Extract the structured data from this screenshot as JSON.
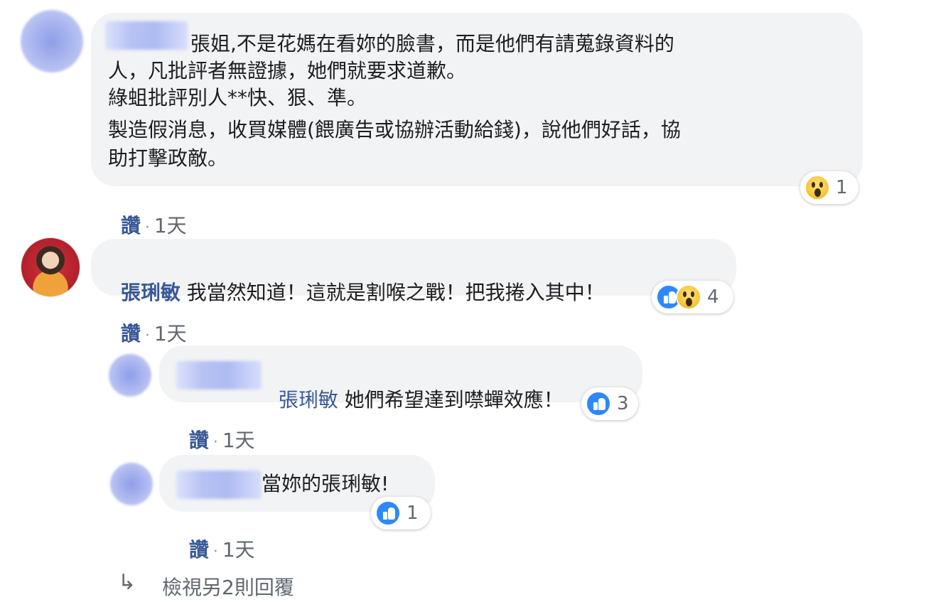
{
  "comments": [
    {
      "name": "",
      "text_lines": [
        "張姐,不是花媽在看妳的臉書，而是他們有請蒐錄資料的",
        "人，凡批評者無證據，她們就要求道歉。",
        "綠蛆批評別人**快、狠、準。",
        "製造假消息，收買媒體(餵廣告或協辦活動給錢)，說他們好話，協",
        "助打擊政敵。"
      ],
      "like_label": "讚",
      "time": "1天",
      "reactions": [
        "wow"
      ],
      "reaction_count": "1"
    },
    {
      "name": "張琍敏",
      "text": "我當然知道！這就是割喉之戰！把我捲入其中！",
      "like_label": "讚",
      "time": "1天",
      "reactions": [
        "like",
        "wow"
      ],
      "reaction_count": "4"
    }
  ],
  "replies": [
    {
      "tag": "張琍敏",
      "text": "她們希望達到噤蟬效應！",
      "like_label": "讚",
      "time": "1天",
      "reactions": [
        "like"
      ],
      "reaction_count": "3"
    },
    {
      "text": "當妳的張琍敏!",
      "like_label": "讚",
      "time": "1天",
      "reactions": [
        "like"
      ],
      "reaction_count": "1"
    }
  ],
  "view_more": "檢視另2則回覆",
  "icons": {
    "view_more_arrow": "reply-arrow-icon"
  }
}
